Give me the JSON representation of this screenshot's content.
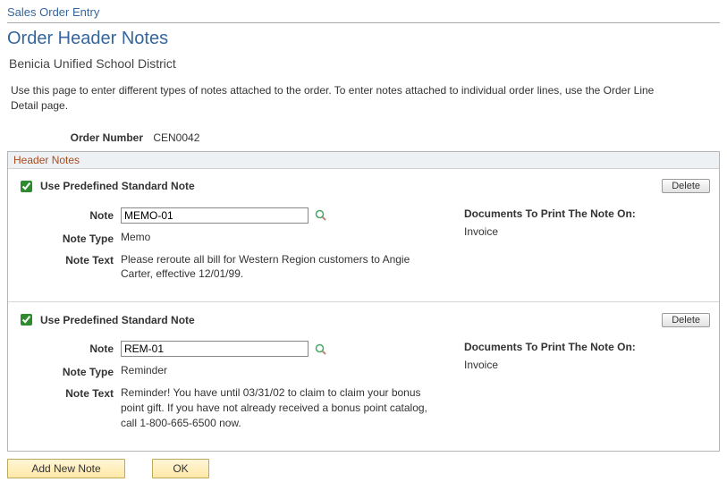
{
  "breadcrumb": "Sales Order Entry",
  "page_title": "Order Header Notes",
  "subtitle": "Benicia Unified School District",
  "instructions": "Use this page to enter different types of notes attached to the order. To enter notes attached to individual order lines, use the Order Line Detail page.",
  "order_number_label": "Order Number",
  "order_number_value": "CEN0042",
  "section_title": "Header Notes",
  "labels": {
    "use_predefined": "Use Predefined Standard Note",
    "note": "Note",
    "note_type": "Note Type",
    "note_text": "Note Text",
    "documents_title": "Documents To Print The Note On:",
    "delete": "Delete",
    "add_new_note": "Add New Note",
    "ok": "OK"
  },
  "notes": [
    {
      "use_predefined": true,
      "note_code": "MEMO-01",
      "note_type": "Memo",
      "note_text": "Please reroute all bill for Western Region customers to Angie Carter, effective 12/01/99.",
      "documents": "Invoice"
    },
    {
      "use_predefined": true,
      "note_code": "REM-01",
      "note_type": "Reminder",
      "note_text": "Reminder!  You have until 03/31/02 to claim to claim your bonus point gift.  If you have not already received a bonus point catalog, call 1-800-665-6500 now.",
      "documents": "Invoice"
    }
  ]
}
